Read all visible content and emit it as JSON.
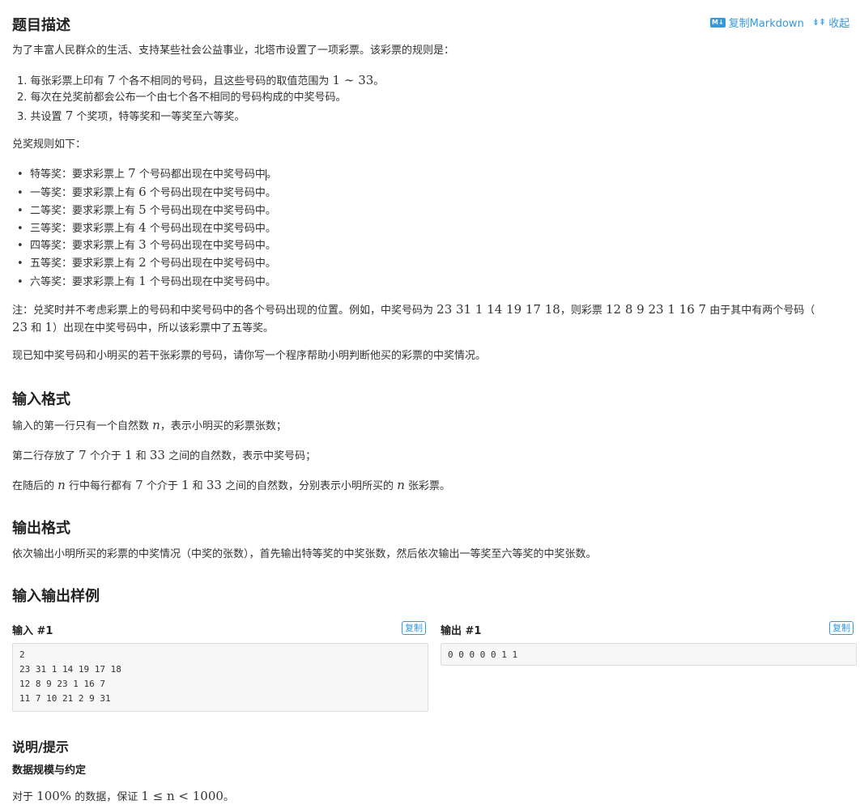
{
  "actions": {
    "copy_markdown": "复制Markdown",
    "collapse": "收起",
    "md_icon_text": "M↓"
  },
  "description": {
    "title": "题目描述",
    "intro": "为了丰富人民群众的生活、支持某些社会公益事业，北塔市设置了一项彩票。该彩票的规则是：",
    "rules": [
      {
        "num": "1.",
        "pre": "每张彩票上印有",
        "m1": "7",
        "mid": "个各不相同的号码，且这些号码的取值范围为",
        "m2": "1 ∼ 33",
        "post": "。"
      },
      {
        "num": "2.",
        "text": "每次在兑奖前都会公布一个由七个各不相同的号码构成的中奖号码。"
      },
      {
        "num": "3.",
        "pre": "共设置",
        "m1": "7",
        "post": "个奖项，特等奖和一等奖至六等奖。"
      }
    ],
    "prize_intro": "兑奖规则如下：",
    "prizes": [
      {
        "pre": "特等奖：要求彩票上",
        "m": "7",
        "post": "个号码都出现在中奖号码中"
      },
      {
        "pre": "一等奖：要求彩票上有",
        "m": "6",
        "post": "个号码出现在中奖号码中。"
      },
      {
        "pre": "二等奖：要求彩票上有",
        "m": "5",
        "post": "个号码出现在中奖号码中。"
      },
      {
        "pre": "三等奖：要求彩票上有",
        "m": "4",
        "post": "个号码出现在中奖号码中。"
      },
      {
        "pre": "四等奖：要求彩票上有",
        "m": "3",
        "post": "个号码出现在中奖号码中。"
      },
      {
        "pre": "五等奖：要求彩票上有",
        "m": "2",
        "post": "个号码出现在中奖号码中。"
      },
      {
        "pre": "六等奖：要求彩票上有",
        "m": "1",
        "post": "个号码出现在中奖号码中。"
      }
    ],
    "prize0_end": "。",
    "note_line1_pre": "注：兑奖时并不考虑彩票上的号码和中奖号码中的各个号码出现的位置。例如，中奖号码为",
    "note_m1": "23 31 1 14 19 17 18",
    "note_mid": "，则彩票",
    "note_m2": "12 8 9 23 1 16 7",
    "note_line1_post": "由于其中有两个号码（",
    "note_m3": "23",
    "note_line2_mid": "和",
    "note_m4": "1",
    "note_line2_post": "）出现在中奖号码中，所以该彩票中了五等奖。",
    "task": "现已知中奖号码和小明买的若干张彩票的号码，请你写一个程序帮助小明判断他买的彩票的中奖情况。"
  },
  "input_format": {
    "title": "输入格式",
    "line1_pre": "输入的第一行只有一个自然数",
    "line1_m": "n",
    "line1_post": "，表示小明买的彩票张数；",
    "line2_pre": "第二行存放了",
    "line2_m1": "7",
    "line2_mid1": "个介于",
    "line2_m2": "1",
    "line2_mid2": "和",
    "line2_m3": "33",
    "line2_post": "之间的自然数，表示中奖号码；",
    "line3_pre": "在随后的",
    "line3_m1": "n",
    "line3_mid1": "行中每行都有",
    "line3_m2": "7",
    "line3_mid2": "个介于",
    "line3_m3": "1",
    "line3_mid3": "和",
    "line3_m4": "33",
    "line3_mid4": "之间的自然数，分别表示小明所买的",
    "line3_m5": "n",
    "line3_post": "张彩票。"
  },
  "output_format": {
    "title": "输出格式",
    "text": "依次输出小明所买的彩票的中奖情况（中奖的张数），首先输出特等奖的中奖张数，然后依次输出一等奖至六等奖的中奖张数。"
  },
  "samples": {
    "title": "输入输出样例",
    "input_label": "输入 #1",
    "output_label": "输出 #1",
    "copy_label": "复制",
    "input_text": "2\n23 31 1 14 19 17 18\n12 8 9 23 1 16 7\n11 7 10 21 2 9 31",
    "output_text": "0 0 0 0 0 1 1"
  },
  "hint": {
    "title": "说明/提示",
    "subtitle": "数据规模与约定",
    "pre": "对于",
    "m1": "100%",
    "mid": "的数据，保证",
    "m2": "1 ≤ n < 1000",
    "post": "。"
  }
}
